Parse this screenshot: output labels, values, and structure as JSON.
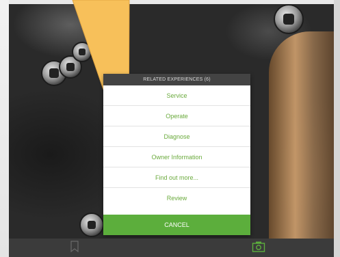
{
  "related_dialog": {
    "header": "RELATED EXPERIENCES (6)",
    "items": [
      "Service",
      "Operate",
      "Diagnose",
      "Owner Information",
      "Find out more...",
      "Review"
    ],
    "cancel_label": "CANCEL"
  },
  "tabbar": {
    "icons": [
      "bookmark-icon",
      "camera-icon"
    ]
  },
  "colors": {
    "accent_green": "#5cae3c",
    "item_text_green": "#6aaa3c",
    "callout_fill": "#f7c05a",
    "header_bg": "#434343",
    "tabbar_bg": "#3b3b3b"
  }
}
